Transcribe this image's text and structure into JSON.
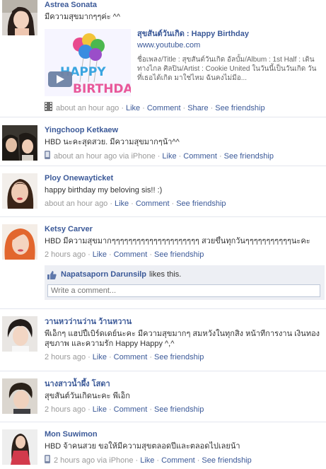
{
  "posts": [
    {
      "author": "Astrea Sonata",
      "message": "มีความสุขมากๆๆค่ะ ^^",
      "attachment": {
        "title": "สุขสันต์วันเกิด : Happy Birthday",
        "url": "www.youtube.com",
        "description": "ชื่อเพลง/Title : สุขสันต์วันเกิด อัลบั้ม/Album : 1st Half : เดินทางไกล ศิลปิน/Artist : Cookie United ในวันนี้เป็นวันเกิด วันที่เธอได้เกิด มาใช่ไหม ฉันคงไม่มีอ...",
        "thumb_text": "HAPPY BIRTHDAY"
      },
      "time": "about an hour ago",
      "actions": [
        "Like",
        "Comment",
        "Share",
        "See friendship"
      ]
    },
    {
      "author": "Yingchoop Ketkaew",
      "message": "HBD นะคะสุดสวย. มีความสุขมากๆน้า^^",
      "time": "about an hour ago via iPhone",
      "actions": [
        "Like",
        "Comment",
        "See friendship"
      ]
    },
    {
      "author": "Ploy Onewayticket",
      "message": "happy birthday my beloving sis!! :)",
      "time": "about an hour ago",
      "actions": [
        "Like",
        "Comment",
        "See friendship"
      ]
    },
    {
      "author": "Ketsy Carver",
      "message": "HBD มีความสุขมากๆๆๆๆๆๆๆๆๆๆๆๆๆๆๆๆๆๆๆๆๆ สวยขึ้นทุกวันๆๆๆๆๆๆๆๆๆๆๆนะคะ",
      "time": "2 hours ago",
      "actions": [
        "Like",
        "Comment",
        "See friendship"
      ],
      "likes": {
        "name": "Napatsaporn Darunsilp",
        "text": "likes this."
      },
      "comment_placeholder": "Write a comment..."
    },
    {
      "author": "วานหวว่านว่าน ว้านหวาน",
      "message": "พี่เอ็กๆ แฮปปี้เบิร์ดเดย์นะคะ มีความสุขมากๆ สมหวังในทุกสิ่ง หน้าที่การงาน เงินทอง สุขภาพ และความรัก Happy Happy ^,^",
      "time": "2 hours ago",
      "actions": [
        "Like",
        "Comment",
        "See friendship"
      ]
    },
    {
      "author": "นางสาวน้ำผึ้ง โสดา",
      "message": "สุขสันต์วันเกิดนะคะ พี่เอ็ก",
      "time": "2 hours ago",
      "actions": [
        "Like",
        "Comment",
        "See friendship"
      ]
    },
    {
      "author": "Mon Suwimon",
      "message": "HBD จ้าคนสวย ขอให้มีความสุขตลอดปีและตลอดไปเลยน้า",
      "time": "2 hours ago via iPhone",
      "actions": [
        "Like",
        "Comment",
        "See friendship"
      ]
    }
  ],
  "colors": {
    "link": "#3b5998",
    "meta": "#999999",
    "likebox": "#edeff4"
  }
}
